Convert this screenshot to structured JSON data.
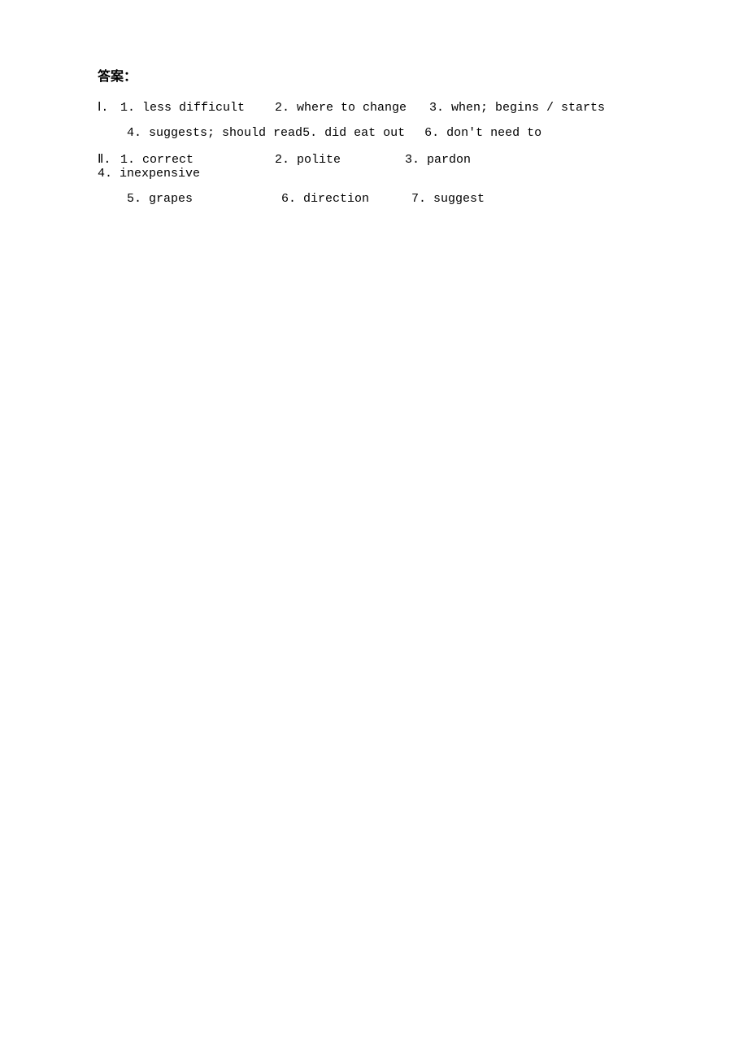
{
  "heading": "答案：",
  "sectionI": {
    "roman": "Ⅰ.",
    "row1": {
      "item1": "1. less difficult",
      "item2": "2. where to change",
      "item3": "3. when; begins / starts"
    },
    "row2": {
      "item4": "4. suggests; should read",
      "item5": "5. did eat out",
      "item6": "6. don't need to"
    }
  },
  "sectionII": {
    "roman": "Ⅱ.",
    "row1": {
      "item1": "1. correct",
      "item2": "2. polite",
      "item3": "3. pardon",
      "item4": "4. inexpensive"
    },
    "row2": {
      "item5": "5. grapes",
      "item6": "6. direction",
      "item7": "7. suggest"
    }
  }
}
